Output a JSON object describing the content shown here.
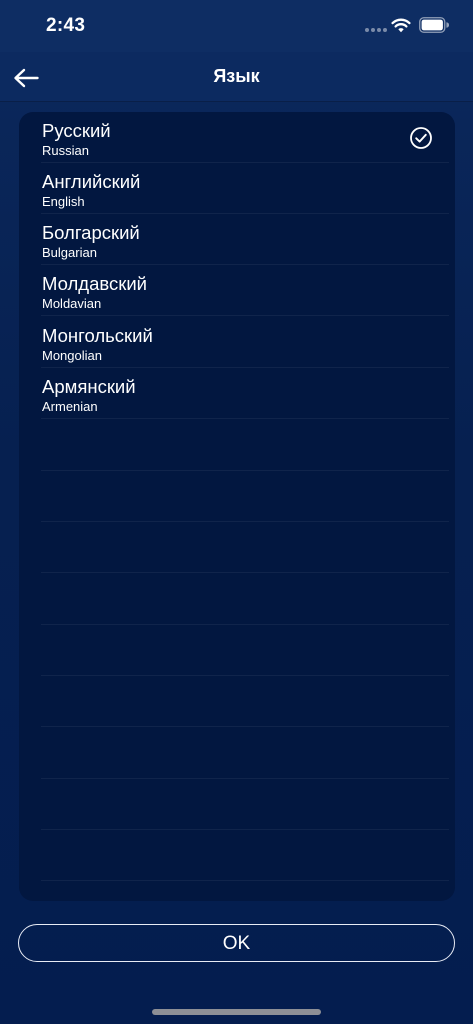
{
  "status_bar": {
    "time": "2:43"
  },
  "nav": {
    "title": "Язык"
  },
  "languages": [
    {
      "name": "Русский",
      "english": "Russian",
      "selected": true
    },
    {
      "name": "Английский",
      "english": "English",
      "selected": false
    },
    {
      "name": "Болгарский",
      "english": "Bulgarian",
      "selected": false
    },
    {
      "name": "Молдавский",
      "english": "Moldavian",
      "selected": false
    },
    {
      "name": "Монгольский",
      "english": "Mongolian",
      "selected": false
    },
    {
      "name": "Армянский",
      "english": "Armenian",
      "selected": false
    }
  ],
  "ok_button": {
    "label": "OK"
  },
  "colors": {
    "background": "#062050",
    "card": "#021740",
    "nav_bar": "#0c2a60",
    "text": "#ffffff"
  }
}
